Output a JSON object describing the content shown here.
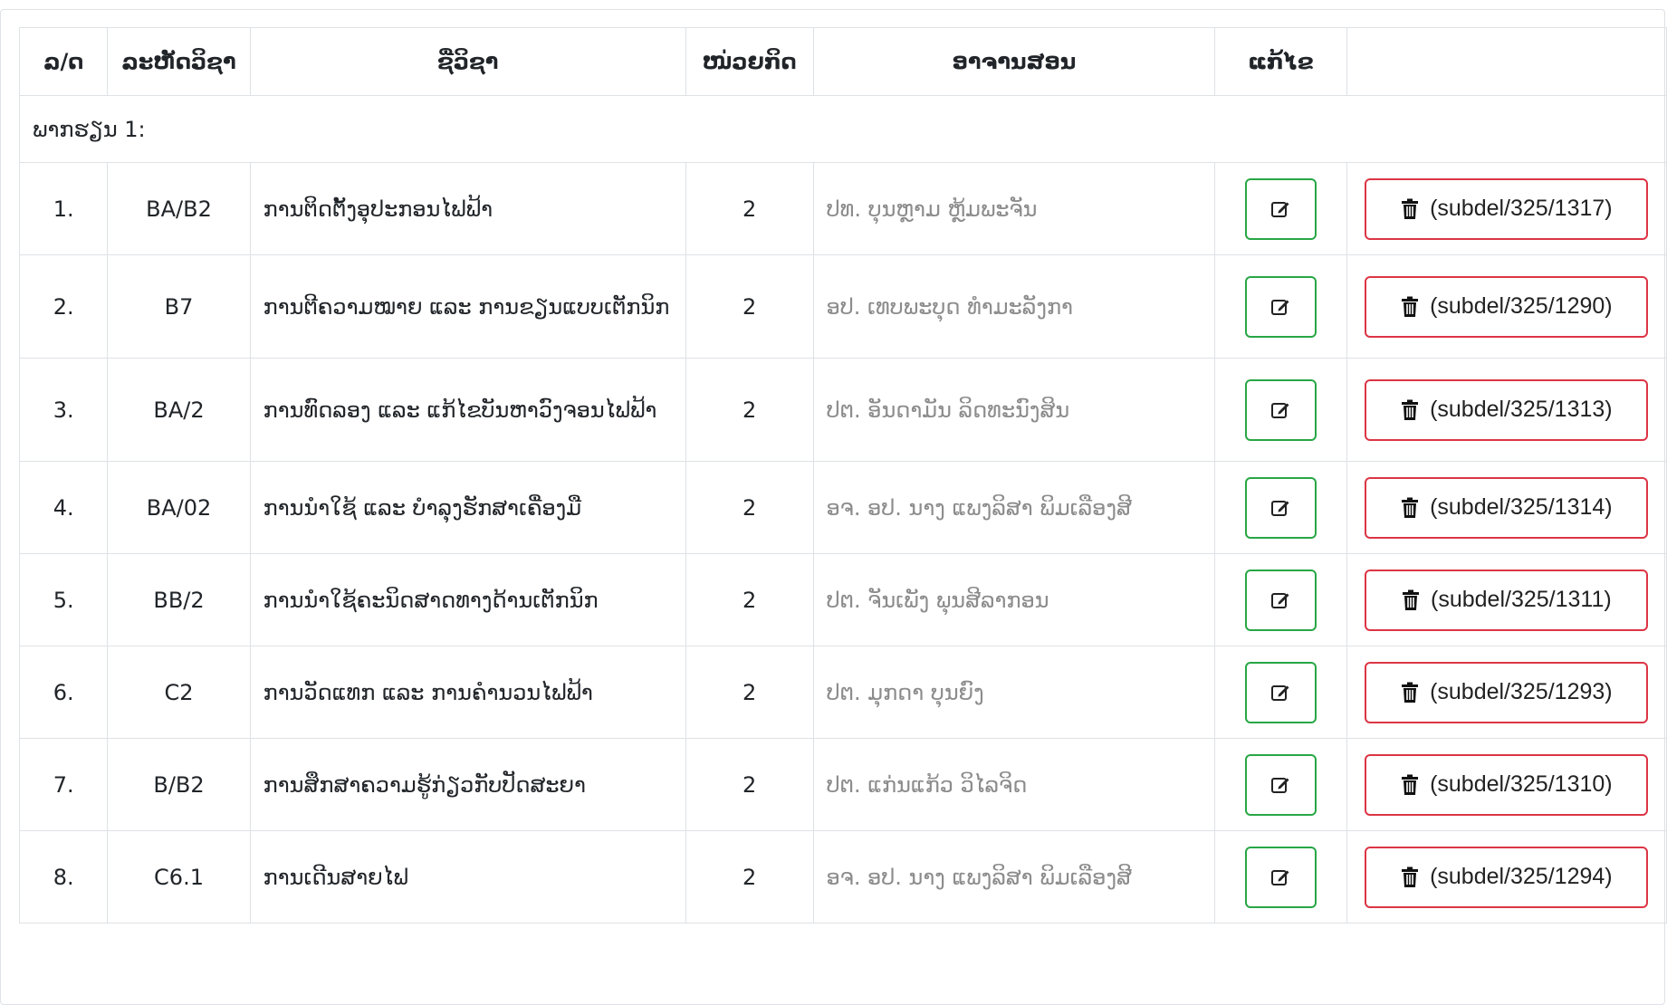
{
  "headers": {
    "no": "ລ/ດ",
    "code": "ລະຫັດວິຊາ",
    "name": "ຊື່ວິຊາ",
    "credit": "ໜ່ວຍກິດ",
    "teacher": "ອາຈານສອນ",
    "edit": "ແກ້ໄຂ",
    "action": ""
  },
  "group_label": "ພາກຮຽນ 1:",
  "icons": {
    "edit": "edit-icon",
    "delete": "trash-icon"
  },
  "colors": {
    "edit_border": "#28a745",
    "delete_border": "#dc3545",
    "teacher_text": "#8c8c8c"
  },
  "rows": [
    {
      "no": "1.",
      "code": "BA/B2",
      "name": "ການຕິດຕັ້ງອຸປະກອນໄຟຟ້າ",
      "credit": "2",
      "teacher": "ປທ. ບຸນຫຼາມ ຫຼ້ມພະຈັນ",
      "delete_label": "(subdel/325/1317)"
    },
    {
      "no": "2.",
      "code": "B7",
      "name": "ການຕີຄວາມໝາຍ ແລະ ການຂຽນແບບເຕັກນິກ",
      "credit": "2",
      "teacher": "ອປ. ເທບພະບຸດ ທຳມະລັງກາ",
      "delete_label": "(subdel/325/1290)"
    },
    {
      "no": "3.",
      "code": "BA/2",
      "name": "ການທົດລອງ ແລະ ແກ້ໄຂບັນຫາວົງຈອນໄຟຟ້າ",
      "credit": "2",
      "teacher": "ປຕ. ອັນດາມັນ ລິດທະນົງສິນ",
      "delete_label": "(subdel/325/1313)"
    },
    {
      "no": "4.",
      "code": "BA/02",
      "name": "ການນຳໃຊ້ ແລະ ບຳລຸງຮັກສາເຄື່ອງມື",
      "credit": "2",
      "teacher": "ອຈ. ອປ. ນາງ ແພງລິສາ ພິມເລືອງສີ",
      "delete_label": "(subdel/325/1314)"
    },
    {
      "no": "5.",
      "code": "BB/2",
      "name": "ການນຳໃຊ້ຄະນິດສາດທາງດ້ານເຕັກນິກ",
      "credit": "2",
      "teacher": "ປຕ. ຈັນເພັງ ພຸນສີລາກອນ",
      "delete_label": "(subdel/325/1311)"
    },
    {
      "no": "6.",
      "code": "C2",
      "name": "ການວັດແທກ ແລະ ການຄຳນວນໄຟຟ້າ",
      "credit": "2",
      "teacher": "ປຕ. ມຸກດາ ບຸນຍົງ",
      "delete_label": "(subdel/325/1293)"
    },
    {
      "no": "7.",
      "code": "B/B2",
      "name": "ການສຶກສາຄວາມຮູ້ກ່ຽວກັບປັດສະຍາ",
      "credit": "2",
      "teacher": "ປຕ. ແກ່ນແກ້ວ ວິໄລຈິດ",
      "delete_label": "(subdel/325/1310)"
    },
    {
      "no": "8.",
      "code": "C6.1",
      "name": "ການເດີນສາຍໄຟ",
      "credit": "2",
      "teacher": "ອຈ. ອປ. ນາງ ແພງລິສາ ພິມເລືອງສີ",
      "delete_label": "(subdel/325/1294)"
    }
  ]
}
